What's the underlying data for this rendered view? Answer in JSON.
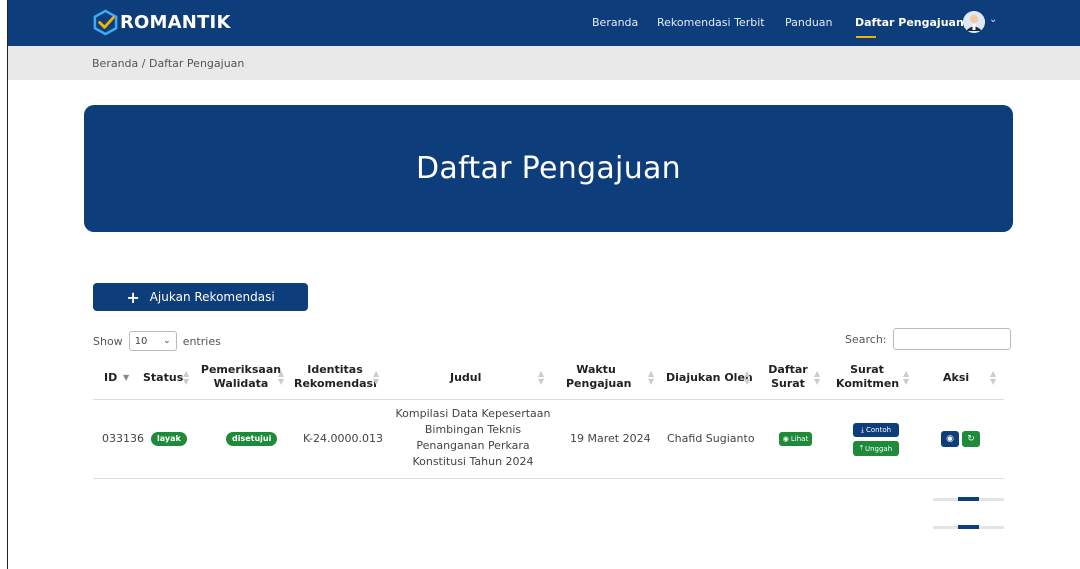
{
  "brand": {
    "name": "ROMANTIK"
  },
  "nav": {
    "items": [
      {
        "label": "Beranda"
      },
      {
        "label": "Rekomendasi Terbit"
      },
      {
        "label": "Panduan"
      },
      {
        "label": "Daftar Pengajuan",
        "active": true
      }
    ]
  },
  "breadcrumb": {
    "text": "Beranda / Daftar Pengajuan"
  },
  "hero": {
    "title": "Daftar Pengajuan"
  },
  "actions": {
    "add_label": "Ajukan Rekomendasi"
  },
  "table_controls": {
    "show_label": "Show",
    "entries_value": "10",
    "entries_label": "entries",
    "search_label": "Search:"
  },
  "table": {
    "headers": {
      "id": "ID",
      "status": "Status",
      "pemeriksaan_1": "Pemeriksaan",
      "pemeriksaan_2": "Walidata",
      "identitas_1": "Identitas",
      "identitas_2": "Rekomendasi",
      "judul": "Judul",
      "waktu_1": "Waktu",
      "waktu_2": "Pengajuan",
      "diajukan": "Diajukan Oleh",
      "daftar_1": "Daftar",
      "daftar_2": "Surat",
      "komitmen_1": "Surat",
      "komitmen_2": "Komitmen",
      "aksi": "Aksi"
    },
    "rows": [
      {
        "id": "033136",
        "status": "layak",
        "pemeriksaan": "disetujui",
        "identitas": "K-24.0000.013",
        "judul_lines": [
          "Kompilasi Data Kepesertaan",
          "Bimbingan Teknis",
          "Penanganan Perkara",
          "Konstitusi Tahun 2024"
        ],
        "waktu": "19 Maret 2024",
        "diajukan_oleh": "Chafid Sugianto",
        "daftar_surat_btn": "Lihat",
        "komitmen_contoh_btn": "Contoh",
        "komitmen_unggah_btn": "Unggah"
      }
    ]
  },
  "colors": {
    "primary": "#0d3d7a",
    "success": "#1e8a3a",
    "accent": "#f0b400"
  },
  "icons": {
    "logo": "check-hexagon-icon",
    "plus": "plus-icon",
    "eye": "eye-icon",
    "refresh": "refresh-icon",
    "download": "download-icon",
    "upload": "upload-icon"
  }
}
